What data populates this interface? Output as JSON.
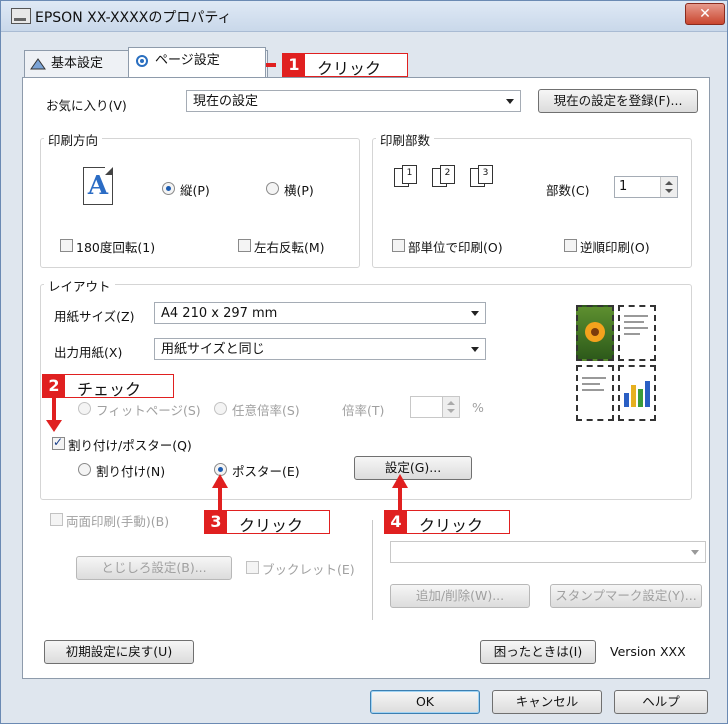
{
  "window": {
    "title": "EPSON XX-XXXXのプロパティ",
    "close": "✕"
  },
  "tabs": [
    {
      "label": "基本設定"
    },
    {
      "label": "ページ設定"
    }
  ],
  "favorites": {
    "label": "お気に入り(V)",
    "value": "現在の設定",
    "register_button": "現在の設定を登録(F)..."
  },
  "orientation": {
    "group_label": "印刷方向",
    "icon_letter": "A",
    "portrait_label": "縦(P)",
    "landscape_label": "横(P)",
    "rotate180_label": "180度回転(1)",
    "mirror_label": "左右反転(M)",
    "selected": "portrait"
  },
  "copies": {
    "group_label": "印刷部数",
    "icons": [
      "1",
      "2",
      "3"
    ],
    "count_label": "部数(C)",
    "count_value": "1",
    "collate_label": "部単位で印刷(O)",
    "reverse_label": "逆順印刷(O)"
  },
  "layout": {
    "group_label": "レイアウト",
    "paper_size_label": "用紙サイズ(Z)",
    "paper_size_value": "A4 210 x 297 mm",
    "output_paper_label": "出力用紙(X)",
    "output_paper_value": "用紙サイズと同じ",
    "fit_page_label": "フィットページ(S)",
    "any_scale_label": "任意倍率(S)",
    "scale_label": "倍率(T)",
    "scale_unit": "%",
    "split_poster_label": "割り付け/ポスター(Q)",
    "split_label": "割り付け(N)",
    "poster_label": "ポスター(E)",
    "settings_button": "設定(G)..."
  },
  "duplex": {
    "label": "両面印刷(手動)(B)",
    "margin_button": "とじしろ設定(B)...",
    "booklet_label": "ブックレット(E)"
  },
  "stamp": {
    "add_delete_button": "追加/削除(W)...",
    "stamp_settings_button": "スタンプマーク設定(Y)..."
  },
  "footer": {
    "reset_button": "初期設定に戻す(U)",
    "help_button": "困ったときは(I)",
    "version": "Version XXX"
  },
  "dialog_buttons": {
    "ok": "OK",
    "cancel": "キャンセル",
    "help": "ヘルプ"
  },
  "annotations": [
    {
      "num": "1",
      "text": "クリック"
    },
    {
      "num": "2",
      "text": "チェック"
    },
    {
      "num": "3",
      "text": "クリック"
    },
    {
      "num": "4",
      "text": "クリック"
    }
  ],
  "colors": {
    "accent": "#e02020",
    "radio_selected": "#1d5cb0",
    "title_bar": "#c9d8ea"
  }
}
